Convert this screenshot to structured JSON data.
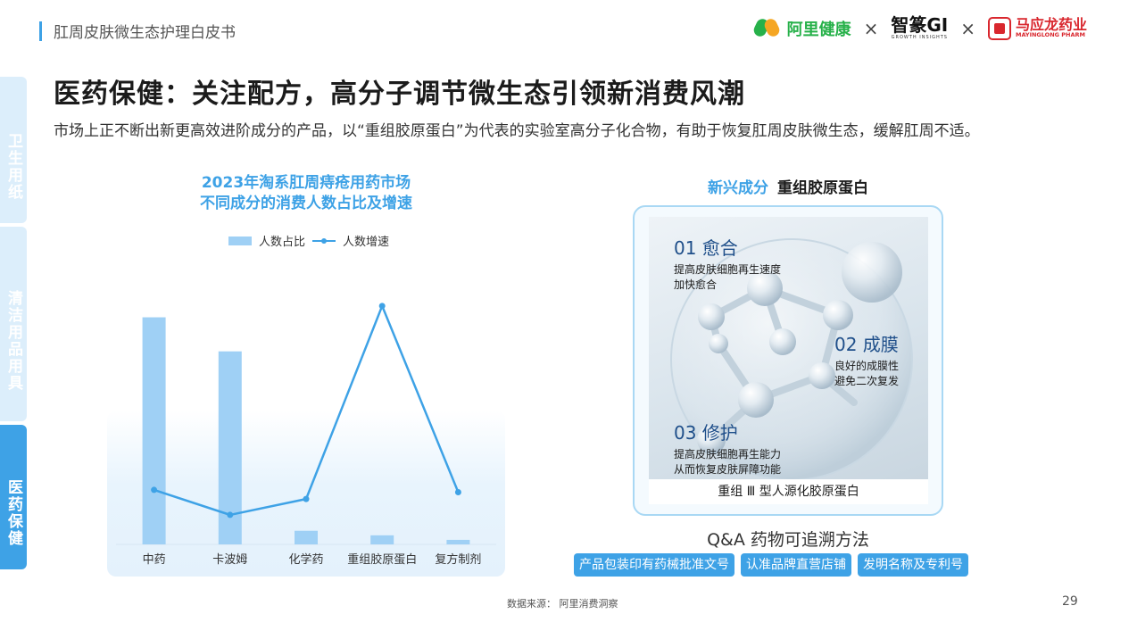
{
  "header": {
    "report_title": "肛周皮肤微生态护理白皮书",
    "logos": {
      "ali": "阿里健康",
      "sep1": "×",
      "zhizhuan": "智篆GI",
      "zhizhuan_sub": "GROWTH INSIGHTS",
      "sep2": "×",
      "myl_cn": "马应龙药业",
      "myl_en": "MAYINGLONG PHARM"
    }
  },
  "sidebar": {
    "tabs": [
      {
        "label": "卫生用纸",
        "active": false
      },
      {
        "label": "清洁用品用具",
        "active": false
      },
      {
        "label": "医药保健",
        "active": true
      }
    ]
  },
  "main": {
    "title": "医药保健：关注配方，高分子调节微生态引领新消费风潮",
    "subtitle": "市场上正不断出新更高效进阶成分的产品，以“重组胶原蛋白”为代表的实验室高分子化合物，有助于恢复肛周皮肤微生态，缓解肛周不适。"
  },
  "chart_data": {
    "type": "bar",
    "title_line1": "2023年淘系肛周痔疮用药市场",
    "title_line2": "不同成分的消费人数占比及增速",
    "categories": [
      "中药",
      "卡波姆",
      "化学药",
      "重组胶原蛋白",
      "复方制剂"
    ],
    "series": [
      {
        "name": "人数占比",
        "kind": "bar",
        "color": "#9fd0f5",
        "values": [
          100,
          85,
          6,
          4,
          2
        ]
      },
      {
        "name": "人数增速",
        "kind": "line",
        "color": "#3ea2e6",
        "values": [
          24,
          13,
          20,
          105,
          23
        ]
      }
    ],
    "ylim": [
      0,
      112
    ],
    "legend_position": "top",
    "grid": false,
    "xlabel": "",
    "ylabel": ""
  },
  "right": {
    "title_highlight": "新兴成分",
    "title_main": "重组胶原蛋白",
    "features": [
      {
        "heading": "01 愈合",
        "line1": "提高皮肤细胞再生速度",
        "line2": "加快愈合"
      },
      {
        "heading": "02 成膜",
        "line1": "良好的成膜性",
        "line2": "避免二次复发"
      },
      {
        "heading": "03 修护",
        "line1": "提高皮肤细胞再生能力",
        "line2": "从而恢复皮肤屏障功能"
      }
    ],
    "caption": "重组 Ⅲ 型人源化胶原蛋白",
    "qa_title": "Q&A 药物可追溯方法",
    "tags": [
      "产品包装印有药械批准文号",
      "认准品牌直营店铺",
      "发明名称及专利号"
    ]
  },
  "footer": {
    "source": "数据来源：  阿里消费洞察",
    "page": "29"
  }
}
